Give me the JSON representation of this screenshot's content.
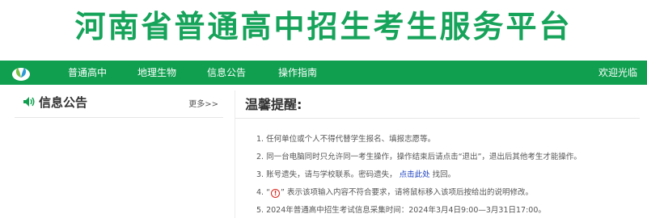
{
  "header": {
    "title": "河南省普通高中招生考生服务平台"
  },
  "nav": {
    "items": [
      "普通高中",
      "地理生物",
      "信息公告",
      "操作指南"
    ],
    "welcome": "欢迎光临"
  },
  "announcements": {
    "title": "信息公告",
    "more": "更多>>"
  },
  "reminder": {
    "title": "温馨提醒:",
    "tips": [
      "1. 任何单位或个人不得代替学生报名、填报志愿等。",
      "2. 同一台电脑同时只允许同一考生操作，操作结束后请点击“退出”，退出后其他考生才能操作。",
      {
        "before": "3. 账号遗失，请与学校联系。密码遗失，",
        "link": "点击此处",
        "after": "找回。"
      },
      {
        "before": "4. “",
        "icon": "!",
        "after": "” 表示该项输入内容不符合要求，请将鼠标移入该项后按给出的说明修改。"
      },
      "5. 2024年普通高中招生考试信息采集时间：2024年3月4日9:00—3月31日17:00。"
    ]
  },
  "colors": {
    "brand_green": "#0f9f4f",
    "title_green": "#16a35a",
    "link_blue": "#1a3fbf",
    "warn_red": "#d8261c"
  }
}
